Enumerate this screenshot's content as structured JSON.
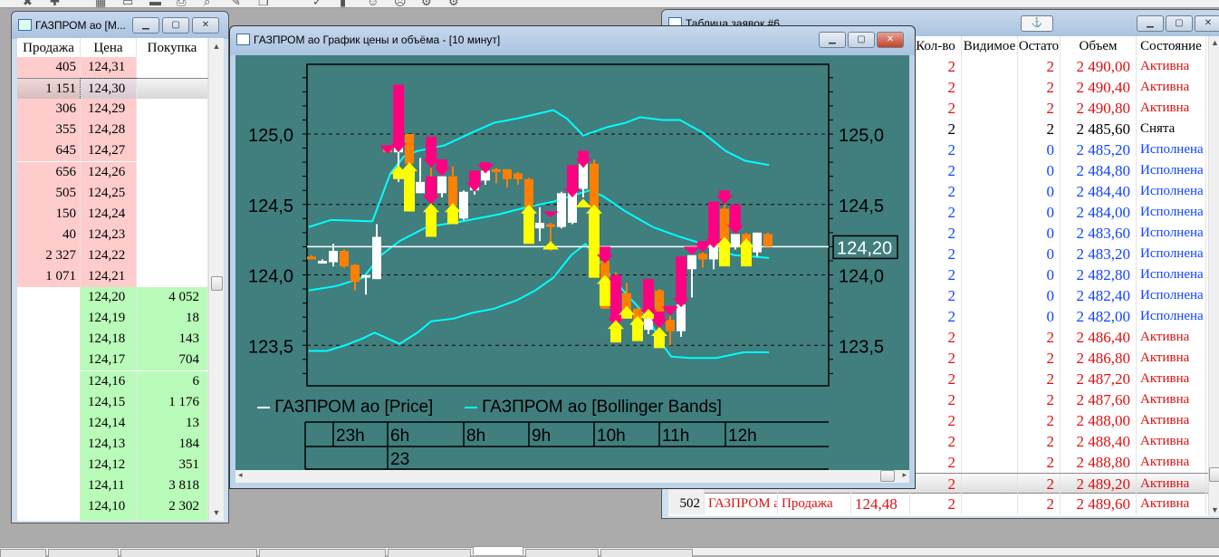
{
  "toolbar": {
    "icons": [
      "cancel-icon",
      "add-icon",
      "chart-icon",
      "window-icon",
      "table-icon",
      "print-icon",
      "search-icon",
      "tools-icon",
      "copy-icon",
      "link-icon",
      "flag-icon",
      "robot-icon",
      "robot-stop-icon",
      "settings-icon",
      "settings-off-icon"
    ]
  },
  "orderbook": {
    "title": "ГАЗПРОМ ао [М...",
    "headers": [
      "Продажа",
      "Цена",
      "Покупка"
    ],
    "sell_rows": [
      [
        "405",
        "124,31"
      ],
      [
        "1 151",
        "124,30"
      ],
      [
        "306",
        "124,29"
      ],
      [
        "355",
        "124,28"
      ],
      [
        "645",
        "124,27"
      ],
      [
        "656",
        "124,26"
      ],
      [
        "505",
        "124,25"
      ],
      [
        "150",
        "124,24"
      ],
      [
        "40",
        "124,23"
      ],
      [
        "2 327",
        "124,22"
      ],
      [
        "1 071",
        "124,21"
      ]
    ],
    "buy_rows": [
      [
        "124,20",
        "4 052"
      ],
      [
        "124,19",
        "18"
      ],
      [
        "124,18",
        "143"
      ],
      [
        "124,17",
        "704"
      ],
      [
        "124,16",
        "6"
      ],
      [
        "124,15",
        "1 176"
      ],
      [
        "124,14",
        "13"
      ],
      [
        "124,13",
        "184"
      ],
      [
        "124,12",
        "351"
      ],
      [
        "124,11",
        "3 818"
      ],
      [
        "124,10",
        "2 302"
      ]
    ],
    "colors": {
      "sell": "#ffcccc",
      "buy": "#b9fbb9"
    }
  },
  "orders": {
    "title": "Таблица заявок #6",
    "anchor": "⚓",
    "headers": [
      "Кол-во",
      "Видимое",
      "Остато",
      "Объем",
      "Состояние"
    ],
    "rows": [
      {
        "qty": "2",
        "vis": "",
        "rest": "2",
        "vol": "2 490,00",
        "state": "Активна",
        "c": "#dd1111"
      },
      {
        "qty": "2",
        "vis": "",
        "rest": "2",
        "vol": "2 490,40",
        "state": "Активна",
        "c": "#dd1111"
      },
      {
        "qty": "2",
        "vis": "",
        "rest": "2",
        "vol": "2 490,80",
        "state": "Активна",
        "c": "#dd1111"
      },
      {
        "qty": "2",
        "vis": "",
        "rest": "2",
        "vol": "2 485,60",
        "state": "Снята",
        "c": "#000000"
      },
      {
        "qty": "2",
        "vis": "",
        "rest": "0",
        "vol": "2 485,20",
        "state": "Исполнена",
        "c": "#1144ff"
      },
      {
        "qty": "2",
        "vis": "",
        "rest": "0",
        "vol": "2 484,80",
        "state": "Исполнена",
        "c": "#1144ff"
      },
      {
        "qty": "2",
        "vis": "",
        "rest": "0",
        "vol": "2 484,40",
        "state": "Исполнена",
        "c": "#1144ff"
      },
      {
        "qty": "2",
        "vis": "",
        "rest": "0",
        "vol": "2 484,00",
        "state": "Исполнена",
        "c": "#1144ff"
      },
      {
        "qty": "2",
        "vis": "",
        "rest": "0",
        "vol": "2 483,60",
        "state": "Исполнена",
        "c": "#1144ff"
      },
      {
        "qty": "2",
        "vis": "",
        "rest": "0",
        "vol": "2 483,20",
        "state": "Исполнена",
        "c": "#1144ff"
      },
      {
        "qty": "2",
        "vis": "",
        "rest": "0",
        "vol": "2 482,80",
        "state": "Исполнена",
        "c": "#1144ff"
      },
      {
        "qty": "2",
        "vis": "",
        "rest": "0",
        "vol": "2 482,40",
        "state": "Исполнена",
        "c": "#1144ff"
      },
      {
        "qty": "2",
        "vis": "",
        "rest": "0",
        "vol": "2 482,00",
        "state": "Исполнена",
        "c": "#1144ff"
      },
      {
        "qty": "2",
        "vis": "",
        "rest": "2",
        "vol": "2 486,40",
        "state": "Активна",
        "c": "#dd1111"
      },
      {
        "qty": "2",
        "vis": "",
        "rest": "2",
        "vol": "2 486,80",
        "state": "Активна",
        "c": "#dd1111"
      },
      {
        "qty": "2",
        "vis": "",
        "rest": "2",
        "vol": "2 487,20",
        "state": "Активна",
        "c": "#dd1111"
      },
      {
        "qty": "2",
        "vis": "",
        "rest": "2",
        "vol": "2 487,60",
        "state": "Активна",
        "c": "#dd1111"
      },
      {
        "qty": "2",
        "vis": "",
        "rest": "2",
        "vol": "2 488,00",
        "state": "Активна",
        "c": "#dd1111"
      },
      {
        "qty": "2",
        "vis": "",
        "rest": "2",
        "vol": "2 488,40",
        "state": "Активна",
        "c": "#dd1111"
      },
      {
        "qty": "2",
        "vis": "",
        "rest": "2",
        "vol": "2 488,80",
        "state": "Активна",
        "c": "#dd1111"
      },
      {
        "qty": "2",
        "vis": "",
        "rest": "2",
        "vol": "2 489,20",
        "state": "Активна",
        "c": "#dd1111",
        "selected": true
      },
      {
        "num": "502",
        "sec": "ГАЗПРОМ ао",
        "op": "Продажа",
        "price": "124,48",
        "qty": "2",
        "vis": "",
        "rest": "2",
        "vol": "2 489,60",
        "state": "Активна",
        "c": "#dd1111"
      }
    ]
  },
  "chart": {
    "title": "ГАЗПРОМ ао График цены и объёма - [10 минут]",
    "current_price_label": "124,20",
    "legend": [
      {
        "label": "ГАЗПРОМ ао [Price]",
        "color": "#ffffff"
      },
      {
        "label": "ГАЗПРОМ ао [Bollinger Bands]",
        "color": "#00ffff"
      }
    ],
    "time_labels": [
      "23h",
      "6h",
      "8h",
      "9h",
      "10h",
      "11h",
      "12h"
    ],
    "date_label": "23",
    "colors": {
      "bg": "#417e7e",
      "up": "#ffffff",
      "down": "#ff8000",
      "sell": "#ff0080",
      "buy": "#ffff00",
      "band": "#00ffff"
    }
  },
  "chart_data": {
    "type": "candlestick",
    "ylim": [
      123.28,
      125.5
    ],
    "yticks": [
      "125,0",
      "124,5",
      "124,0",
      "123,5"
    ],
    "ytick_values": [
      125.0,
      124.5,
      124.0,
      123.5
    ],
    "current_price": 124.2,
    "time_label_candle_index": [
      -0.5,
      2,
      9,
      15,
      21,
      27,
      33
    ],
    "ohlc": [
      [
        124.13,
        124.14,
        124.11,
        124.12
      ],
      [
        124.1,
        124.11,
        124.08,
        124.1
      ],
      [
        124.09,
        124.22,
        124.06,
        124.17
      ],
      [
        124.17,
        124.18,
        124.05,
        124.06
      ],
      [
        124.07,
        124.08,
        123.89,
        123.95
      ],
      [
        123.98,
        124.0,
        123.86,
        124.0
      ],
      [
        123.97,
        124.36,
        123.97,
        124.27
      ],
      [
        124.89,
        124.9,
        124.88,
        124.88
      ],
      [
        124.87,
        124.92,
        124.66,
        124.92
      ],
      [
        125.0,
        125.0,
        124.5,
        124.79
      ],
      [
        124.58,
        124.83,
        124.58,
        124.66
      ],
      [
        124.68,
        124.76,
        124.56,
        124.62
      ],
      [
        124.58,
        124.7,
        124.55,
        124.7
      ],
      [
        124.7,
        124.77,
        124.49,
        124.49
      ],
      [
        124.4,
        124.6,
        124.39,
        124.59
      ],
      [
        124.6,
        124.63,
        124.57,
        124.63
      ],
      [
        124.67,
        124.74,
        124.64,
        124.74
      ],
      [
        124.75,
        124.76,
        124.65,
        124.75
      ],
      [
        124.75,
        124.75,
        124.62,
        124.68
      ],
      [
        124.72,
        124.73,
        124.64,
        124.68
      ],
      [
        124.68,
        124.69,
        124.48,
        124.48
      ],
      [
        124.33,
        124.48,
        124.24,
        124.37
      ],
      [
        124.36,
        124.37,
        124.17,
        124.35
      ],
      [
        124.34,
        124.59,
        124.33,
        124.58
      ],
      [
        124.37,
        124.62,
        124.36,
        124.61
      ],
      [
        124.61,
        124.8,
        124.55,
        124.79
      ],
      [
        124.79,
        124.82,
        123.98,
        123.98
      ],
      [
        124.1,
        124.12,
        123.76,
        123.76
      ],
      [
        124.0,
        124.02,
        123.7,
        123.72
      ],
      [
        123.87,
        123.94,
        123.69,
        123.69
      ],
      [
        123.76,
        123.77,
        123.66,
        123.66
      ],
      [
        123.61,
        123.69,
        123.58,
        123.69
      ],
      [
        123.89,
        123.9,
        123.73,
        123.73
      ],
      [
        123.68,
        123.71,
        123.5,
        123.6
      ],
      [
        123.6,
        123.8,
        123.56,
        123.79
      ],
      [
        124.04,
        124.14,
        123.84,
        124.14
      ],
      [
        124.15,
        124.16,
        124.05,
        124.11
      ],
      [
        124.11,
        124.25,
        124.04,
        124.24
      ],
      [
        124.47,
        124.5,
        124.24,
        124.24
      ],
      [
        124.2,
        124.29,
        124.18,
        124.29
      ],
      [
        124.29,
        124.3,
        124.21,
        124.21
      ],
      [
        124.16,
        124.3,
        124.13,
        124.3
      ],
      [
        124.29,
        124.3,
        124.2,
        124.2
      ]
    ],
    "trades": [
      {
        "i": 7,
        "t": "sell",
        "top": 124.92,
        "bot": 124.86
      },
      {
        "i": 8,
        "t": "sell",
        "top": 125.35,
        "bot": 124.87
      },
      {
        "i": 8,
        "t": "buy",
        "top": 124.78,
        "bot": 124.68
      },
      {
        "i": 9,
        "t": "buy",
        "top": 124.8,
        "bot": 124.45
      },
      {
        "i": 11,
        "t": "sell",
        "top": 124.98,
        "bot": 124.76
      },
      {
        "i": 12,
        "t": "sell",
        "top": 124.82,
        "bot": 124.7
      },
      {
        "i": 11,
        "t": "sell",
        "top": 124.7,
        "bot": 124.5
      },
      {
        "i": 11,
        "t": "buy",
        "top": 124.51,
        "bot": 124.27
      },
      {
        "i": 13,
        "t": "buy",
        "top": 124.51,
        "bot": 124.36
      },
      {
        "i": 15,
        "t": "sell",
        "top": 124.74,
        "bot": 124.59
      },
      {
        "i": 16,
        "t": "sell",
        "top": 124.8,
        "bot": 124.72
      },
      {
        "i": 20,
        "t": "buy",
        "top": 124.5,
        "bot": 124.22
      },
      {
        "i": 22,
        "t": "sell",
        "top": 124.45,
        "bot": 124.41
      },
      {
        "i": 22,
        "t": "buy",
        "top": 124.24,
        "bot": 124.18
      },
      {
        "i": 24,
        "t": "sell",
        "top": 124.78,
        "bot": 124.55
      },
      {
        "i": 25,
        "t": "sell",
        "top": 124.88,
        "bot": 124.76
      },
      {
        "i": 25,
        "t": "buy",
        "top": 124.54,
        "bot": 124.48
      },
      {
        "i": 26,
        "t": "buy",
        "top": 124.5,
        "bot": 123.98
      },
      {
        "i": 27,
        "t": "sell",
        "top": 124.2,
        "bot": 124.08
      },
      {
        "i": 27,
        "t": "buy",
        "top": 124.0,
        "bot": 123.78
      },
      {
        "i": 28,
        "t": "sell",
        "top": 124.0,
        "bot": 123.63
      },
      {
        "i": 28,
        "t": "buy",
        "top": 123.68,
        "bot": 123.52
      },
      {
        "i": 29,
        "t": "buy",
        "top": 123.78,
        "bot": 123.69
      },
      {
        "i": 30,
        "t": "buy",
        "top": 123.71,
        "bot": 123.53
      },
      {
        "i": 31,
        "t": "sell",
        "top": 123.97,
        "bot": 123.69
      },
      {
        "i": 31,
        "t": "buy",
        "top": 123.76,
        "bot": 123.69
      },
      {
        "i": 32,
        "t": "sell",
        "top": 123.74,
        "bot": 123.62
      },
      {
        "i": 32,
        "t": "buy",
        "top": 123.63,
        "bot": 123.48
      },
      {
        "i": 33,
        "t": "sell",
        "top": 123.78,
        "bot": 123.71
      },
      {
        "i": 34,
        "t": "sell",
        "top": 124.13,
        "bot": 123.77
      },
      {
        "i": 35,
        "t": "sell",
        "top": 124.2,
        "bot": 124.14
      },
      {
        "i": 36,
        "t": "sell",
        "top": 124.24,
        "bot": 124.16
      },
      {
        "i": 37,
        "t": "sell",
        "top": 124.52,
        "bot": 124.19
      },
      {
        "i": 38,
        "t": "sell",
        "top": 124.6,
        "bot": 124.5
      },
      {
        "i": 38,
        "t": "buy",
        "top": 124.27,
        "bot": 124.06
      },
      {
        "i": 39,
        "t": "sell",
        "top": 124.5,
        "bot": 124.29
      },
      {
        "i": 40,
        "t": "buy",
        "top": 124.26,
        "bot": 124.06
      }
    ],
    "bands": {
      "upper": [
        [
          -0.25,
          124.34
        ],
        [
          1.8,
          124.39
        ],
        [
          5.6,
          124.38
        ],
        [
          7.25,
          124.72
        ],
        [
          8.5,
          124.84
        ],
        [
          9.75,
          124.88
        ],
        [
          12.25,
          124.92
        ],
        [
          14.75,
          125.01
        ],
        [
          16.8,
          125.08
        ],
        [
          18.9,
          125.11
        ],
        [
          22.25,
          125.17
        ],
        [
          23.5,
          125.11
        ],
        [
          25,
          124.99
        ],
        [
          27.25,
          125.05
        ],
        [
          28.9,
          125.08
        ],
        [
          30.25,
          125.12
        ],
        [
          32.25,
          125.1
        ],
        [
          33.9,
          125.1
        ],
        [
          36,
          125.01
        ],
        [
          38.1,
          124.88
        ],
        [
          39.9,
          124.81
        ],
        [
          42.1,
          124.78
        ]
      ],
      "middle": [
        [
          -0.25,
          123.89
        ],
        [
          2.25,
          123.92
        ],
        [
          4.75,
          123.98
        ],
        [
          6.4,
          124.14
        ],
        [
          8.1,
          124.24
        ],
        [
          10.6,
          124.34
        ],
        [
          13.9,
          124.38
        ],
        [
          17.25,
          124.43
        ],
        [
          19.75,
          124.48
        ],
        [
          22.25,
          124.52
        ],
        [
          23.9,
          124.56
        ],
        [
          25.6,
          124.6
        ],
        [
          26.8,
          124.56
        ],
        [
          28.9,
          124.45
        ],
        [
          31.4,
          124.34
        ],
        [
          33.9,
          124.27
        ],
        [
          35.6,
          124.23
        ],
        [
          37.25,
          124.18
        ],
        [
          38.9,
          124.14
        ],
        [
          40.6,
          124.13
        ],
        [
          42.1,
          124.12
        ]
      ],
      "lower": [
        [
          -0.25,
          123.46
        ],
        [
          1.4,
          123.46
        ],
        [
          3.1,
          123.5
        ],
        [
          4.75,
          123.55
        ],
        [
          5.8,
          123.59
        ],
        [
          8.1,
          123.51
        ],
        [
          9.75,
          123.59
        ],
        [
          11,
          123.67
        ],
        [
          13.1,
          123.69
        ],
        [
          14.75,
          123.73
        ],
        [
          16.8,
          123.76
        ],
        [
          18.9,
          123.82
        ],
        [
          20.6,
          123.89
        ],
        [
          22.25,
          123.98
        ],
        [
          23.9,
          124.14
        ],
        [
          25.2,
          124.22
        ],
        [
          28.1,
          123.94
        ],
        [
          31,
          123.69
        ],
        [
          32.25,
          123.51
        ],
        [
          33.1,
          123.42
        ],
        [
          34.75,
          123.41
        ],
        [
          37.25,
          123.41
        ],
        [
          39.75,
          123.45
        ],
        [
          42.1,
          123.45
        ]
      ]
    }
  }
}
